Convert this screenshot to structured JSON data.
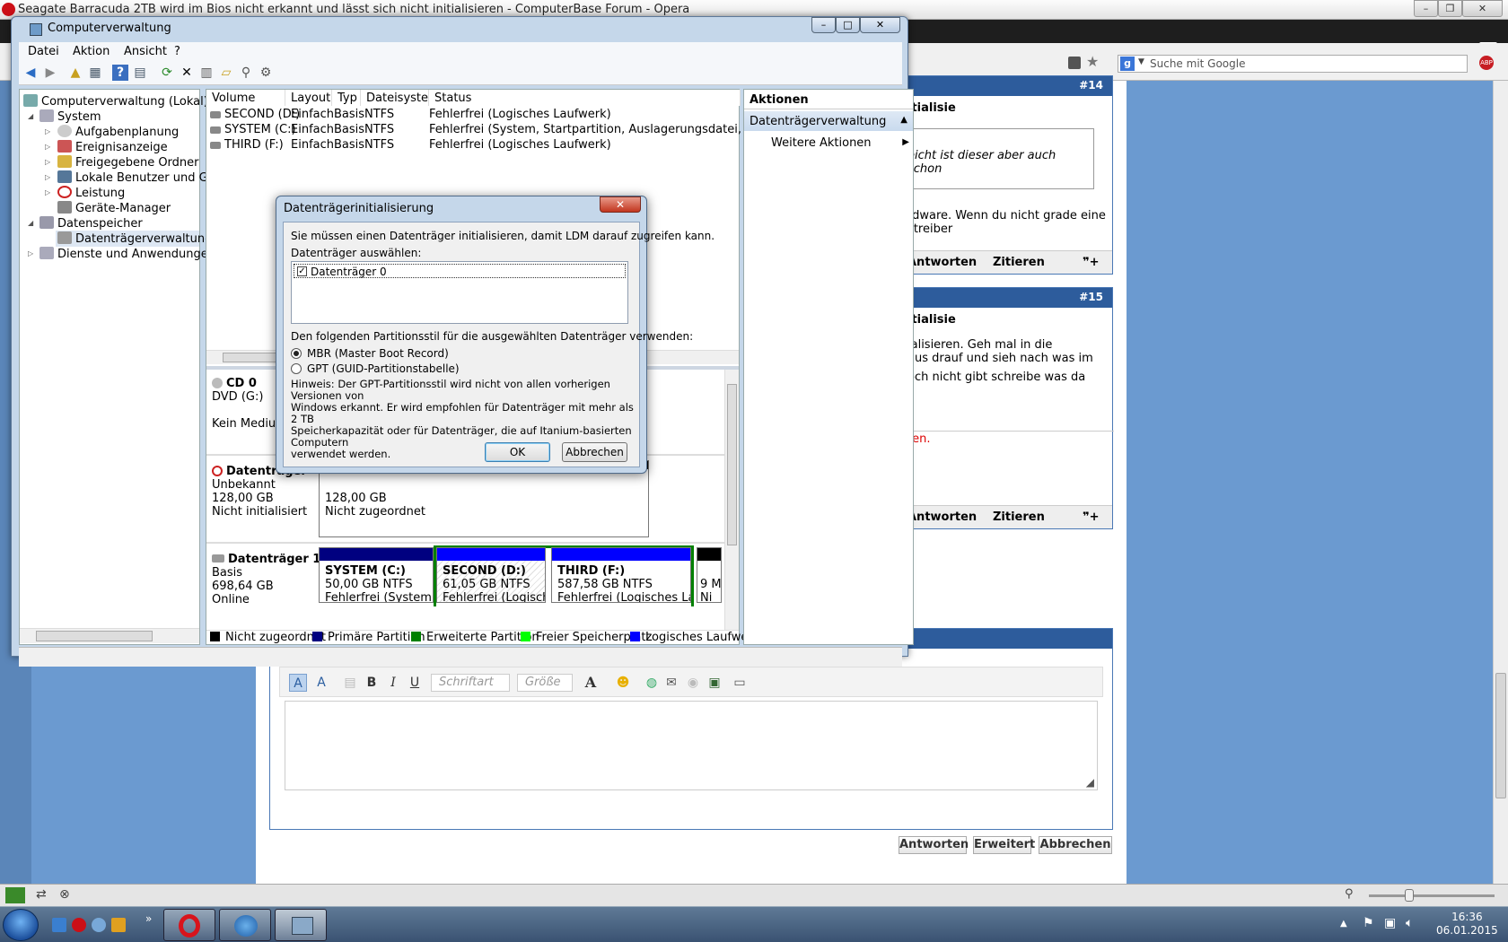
{
  "opera": {
    "title": "Seagate Barracuda 2TB wird im Bios nicht erkannt und lässt sich nicht initialisieren - ComputerBase Forum - Opera",
    "search_placeholder": "Suche mit Google",
    "search_engine_icon": "g",
    "abp_label": "ABP"
  },
  "forum": {
    "post14": {
      "number": "#14",
      "title": "itialisie",
      "quote": "eicht ist dieser aber auch schon",
      "text1": "rdware. Wenn du nicht grade eine",
      "text2": "ztreiber",
      "reply": "Antworten",
      "quote_btn": "Zitieren"
    },
    "post15": {
      "number": "#15",
      "title": "itialisie",
      "text1": "ialisieren. Geh mal in die",
      "text2": "aus drauf und sieh nach was im",
      "text3": "och nicht gibt schreibe was da",
      "red_text": "ten.",
      "reply": "Antworten",
      "quote_btn": "Zitieren"
    },
    "editor": {
      "font_placeholder": "Schriftart",
      "size_placeholder": "Größe"
    },
    "buttons": {
      "reply": "Antworten",
      "advanced": "Erweitert",
      "cancel": "Abbrechen"
    }
  },
  "cm": {
    "title": "Computerverwaltung",
    "menu": [
      "Datei",
      "Aktion",
      "Ansicht",
      "?"
    ],
    "tree": {
      "root": "Computerverwaltung (Lokal)",
      "system": "System",
      "task_scheduler": "Aufgabenplanung",
      "event_viewer": "Ereignisanzeige",
      "shared_folders": "Freigegebene Ordner",
      "local_users": "Lokale Benutzer und Gr",
      "performance": "Leistung",
      "device_manager": "Geräte-Manager",
      "storage": "Datenspeicher",
      "disk_mgmt": "Datenträgerverwaltung",
      "services": "Dienste und Anwendungen"
    },
    "volume_columns": [
      "Volume",
      "Layout",
      "Typ",
      "Dateisystem",
      "Status"
    ],
    "volumes": [
      {
        "name": "SECOND (D:)",
        "layout": "Einfach",
        "type": "Basis",
        "fs": "NTFS",
        "status": "Fehlerfrei (Logisches Laufwerk)"
      },
      {
        "name": "SYSTEM (C:)",
        "layout": "Einfach",
        "type": "Basis",
        "fs": "NTFS",
        "status": "Fehlerfrei (System, Startpartition, Auslagerungsdatei, Aktiv, Abs"
      },
      {
        "name": "THIRD (F:)",
        "layout": "Einfach",
        "type": "Basis",
        "fs": "NTFS",
        "status": "Fehlerfrei (Logisches Laufwerk)"
      }
    ],
    "cd": {
      "name": "CD 0",
      "drive": "DVD (G:)",
      "medium": "Kein Medium"
    },
    "disk0": {
      "name": "Datenträger",
      "kind": "Unbekannt",
      "size": "128,00 GB",
      "state": "Nicht initialisiert",
      "part_size": "128,00 GB",
      "part_state": "Nicht zugeordnet"
    },
    "disk1": {
      "name": "Datenträger 1",
      "kind": "Basis",
      "size": "698,64 GB",
      "state": "Online",
      "parts": [
        {
          "name": "SYSTEM  (C:)",
          "size": "50,00 GB NTFS",
          "status": "Fehlerfrei (System, Sta"
        },
        {
          "name": "SECOND  (D:)",
          "size": "61,05 GB NTFS",
          "status": "Fehlerfrei (Logisches"
        },
        {
          "name": "THIRD  (F:)",
          "size": "587,58 GB NTFS",
          "status": "Fehlerfrei (Logisches Laufv"
        },
        {
          "name": "",
          "size": "9 M",
          "status": "Ni"
        }
      ]
    },
    "legend": [
      {
        "label": "Nicht zugeordnet",
        "color": "#000000"
      },
      {
        "label": "Primäre Partition",
        "color": "#000080"
      },
      {
        "label": "Erweiterte Partition",
        "color": "#008000"
      },
      {
        "label": "Freier Speicherplatz",
        "color": "#00ff00"
      },
      {
        "label": "Logisches Laufwerk",
        "color": "#0000ff"
      }
    ],
    "actions": {
      "header": "Aktionen",
      "group": "Datenträgerverwaltung",
      "more": "Weitere Aktionen"
    }
  },
  "dialog": {
    "title": "Datenträgerinitialisierung",
    "intro": "Sie müssen einen Datenträger initialisieren, damit LDM darauf zugreifen kann.",
    "select_label": "Datenträger auswählen:",
    "disk_item": "Datenträger 0",
    "style_label": "Den folgenden Partitionsstil für die ausgewählten Datenträger verwenden:",
    "mbr": "MBR (Master Boot Record)",
    "gpt": "GPT (GUID-Partitionstabelle)",
    "hint1": "Hinweis: Der GPT-Partitionsstil wird nicht von allen vorherigen Versionen von",
    "hint2": "Windows erkannt. Er wird empfohlen für Datenträger mit mehr als 2 TB",
    "hint3": "Speicherkapazität oder für Datenträger, die auf Itanium-basierten Computern",
    "hint4": "verwendet werden.",
    "ok": "OK",
    "cancel": "Abbrechen"
  },
  "taskbar": {
    "time": "16:36",
    "date": "06.01.2015"
  }
}
